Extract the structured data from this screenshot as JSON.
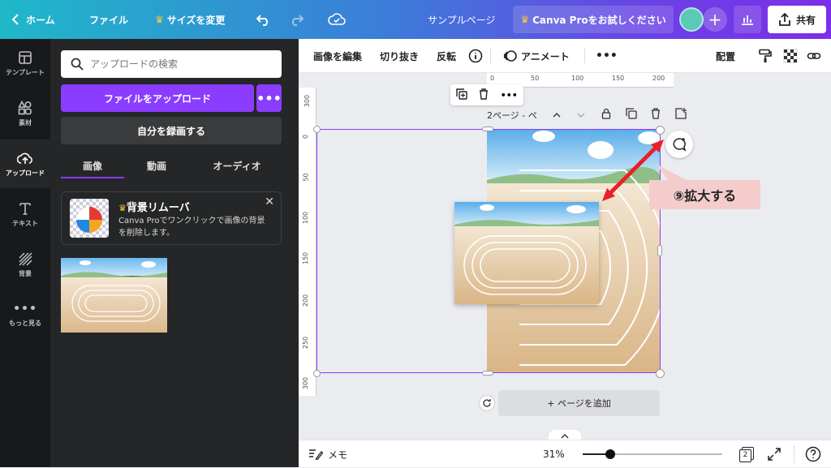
{
  "topbar": {
    "home": "ホーム",
    "file": "ファイル",
    "resize": "サイズを変更",
    "page_name": "サンプルページ",
    "pro_trial": "Canva Proをお試しください",
    "share": "共有"
  },
  "rail": {
    "items": [
      {
        "label": "テンプレート",
        "icon": "template-icon"
      },
      {
        "label": "素材",
        "icon": "elements-icon"
      },
      {
        "label": "アップロード",
        "icon": "upload-icon"
      },
      {
        "label": "テキスト",
        "icon": "text-icon"
      },
      {
        "label": "背景",
        "icon": "background-icon"
      },
      {
        "label": "もっと見る",
        "icon": "more-icon"
      }
    ]
  },
  "panel": {
    "search_placeholder": "アップロードの検索",
    "upload_button": "ファイルをアップロード",
    "record_button": "自分を録画する",
    "tabs": [
      "画像",
      "動画",
      "オーディオ"
    ],
    "promo": {
      "title": "背景リムーバ",
      "desc": "Canva Proでワンクリックで画像の背景を削除します。"
    }
  },
  "toolbar": {
    "edit_image": "画像を編集",
    "crop": "切り抜き",
    "flip": "反転",
    "animate": "アニメート",
    "position": "配置"
  },
  "canvas": {
    "page_label": "2ページ - ペ",
    "add_page": "+ ページを追加",
    "ruler_top": [
      "0",
      "50",
      "100",
      "150",
      "200"
    ],
    "ruler_left": [
      "300",
      "0",
      "50",
      "100",
      "150",
      "200",
      "250",
      "300"
    ],
    "callout": "⑨拡大する"
  },
  "bottombar": {
    "notes": "メモ",
    "zoom": "31%",
    "zoom_fraction": 0.2,
    "page_count": "2"
  },
  "colors": {
    "accent": "#8b3dff",
    "arrow": "#e8202a"
  }
}
